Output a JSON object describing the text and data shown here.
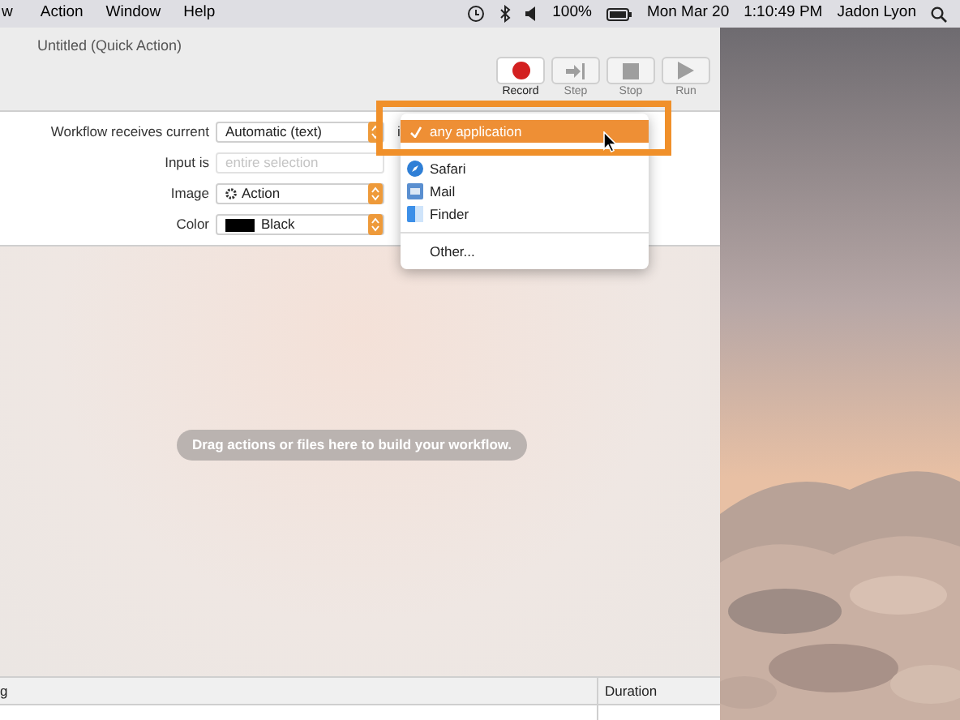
{
  "menu_bar": {
    "menus": [
      "w",
      "Action",
      "Window",
      "Help"
    ],
    "battery": "100%",
    "date": "Mon Mar 20",
    "time": "1:10:49 PM",
    "user": "Jadon Lyon"
  },
  "window": {
    "title": "Untitled (Quick Action)"
  },
  "toolbar": [
    {
      "label": "Record",
      "kind": "record",
      "disabled": false
    },
    {
      "label": "Step",
      "kind": "step",
      "disabled": true
    },
    {
      "label": "Stop",
      "kind": "stop",
      "disabled": true
    },
    {
      "label": "Run",
      "kind": "run",
      "disabled": true
    }
  ],
  "form": {
    "receives_label": "Workflow receives current",
    "receives_value": "Automatic (text)",
    "in_label": "i",
    "input_label": "Input is",
    "input_placeholder": "entire selection",
    "image_label": "Image",
    "image_value": "Action",
    "color_label": "Color",
    "color_value": "Black"
  },
  "dropdown": {
    "items": [
      {
        "kind": "item",
        "label": "any application",
        "selected": true
      },
      {
        "kind": "separator"
      },
      {
        "kind": "browser",
        "label": "Safari",
        "selected": false
      },
      {
        "kind": "mail",
        "label": "Mail",
        "selected": false
      },
      {
        "kind": "finder",
        "label": "Finder",
        "selected": false
      },
      {
        "kind": "separator"
      },
      {
        "kind": "item",
        "label": "Other...",
        "selected": false
      }
    ]
  },
  "canvas": {
    "hint": "Drag actions or files here to build your workflow."
  },
  "log_table": {
    "columns": [
      "g",
      "Duration"
    ]
  }
}
